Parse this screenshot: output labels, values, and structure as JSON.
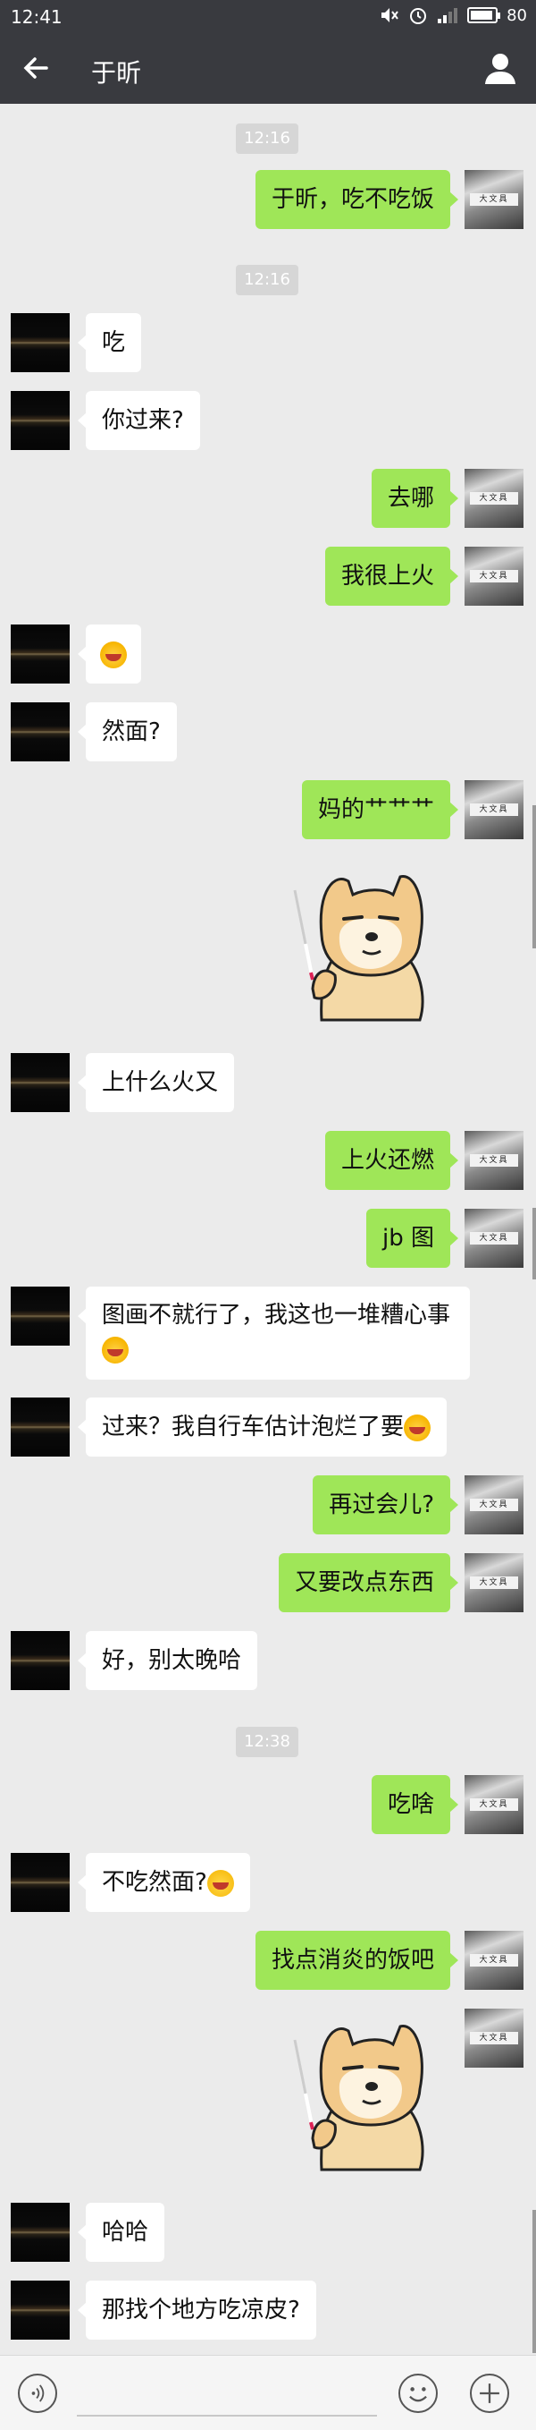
{
  "status": {
    "time": "12:41",
    "battery": "80"
  },
  "header": {
    "title": "于昕"
  },
  "avatar_text": "大文具",
  "timestamps": [
    "12:16",
    "12:16",
    "12:38"
  ],
  "messages": [
    {
      "text": "于昕，吃不吃饭"
    },
    {
      "text": "吃"
    },
    {
      "text": "你过来?"
    },
    {
      "text": "去哪"
    },
    {
      "text": "我很上火"
    },
    {
      "text": ""
    },
    {
      "text": "然面?"
    },
    {
      "text": "妈的艹艹艹"
    },
    {
      "text": "上什么火又"
    },
    {
      "text": "上火还燃"
    },
    {
      "text": "jb 图"
    },
    {
      "text": "图画不就行了，我这也一堆糟心事"
    },
    {
      "text": "过来？我自行车估计泡烂了要"
    },
    {
      "text": "再过会儿?"
    },
    {
      "text": "又要改点东西"
    },
    {
      "text": "好，别太晚哈"
    },
    {
      "text": "吃啥"
    },
    {
      "text": "不吃然面?"
    },
    {
      "text": "找点消炎的饭吧"
    },
    {
      "text": "哈哈"
    },
    {
      "text": "那找个地方吃凉皮?"
    }
  ],
  "icons": [
    "back-arrow-icon",
    "user-icon",
    "mute-icon",
    "alarm-icon",
    "signal-icon",
    "battery-icon",
    "voice-icon",
    "emoji-icon",
    "plus-icon"
  ]
}
